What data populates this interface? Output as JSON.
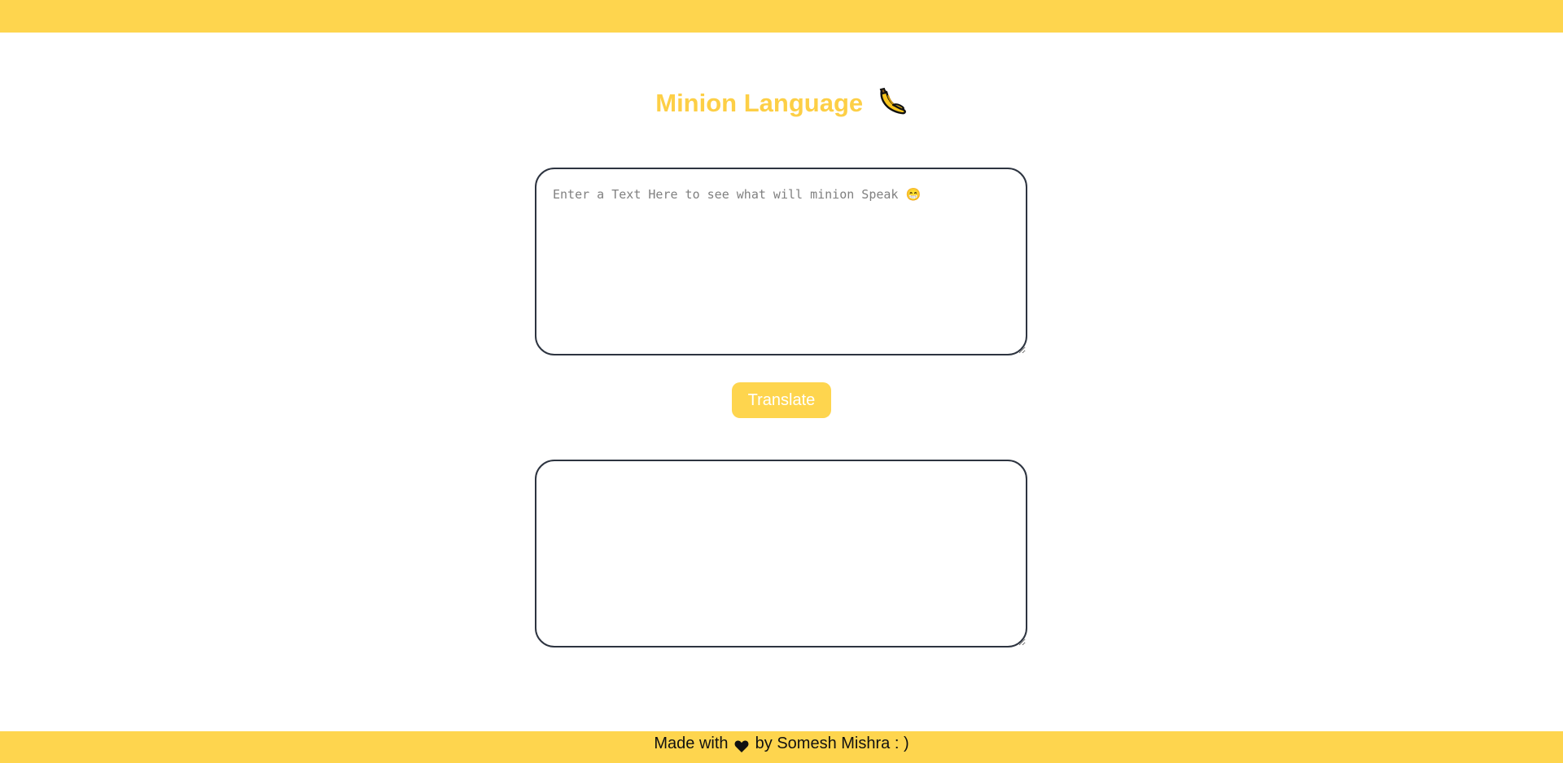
{
  "header": {
    "title": "Minion Language",
    "title_icon": "banana-icon",
    "bar_color": "#fed54e"
  },
  "input": {
    "placeholder": "Enter a Text Here to see what will minion Speak 😁",
    "value": ""
  },
  "translate_button": {
    "label": "Translate"
  },
  "output": {
    "value": ""
  },
  "footer": {
    "text_before": "Made with",
    "heart_icon": "heart-icon",
    "text_after": "by Somesh Mishra : )"
  },
  "colors": {
    "accent": "#fed54e",
    "title": "#fdcf46",
    "border": "#2d3440"
  }
}
